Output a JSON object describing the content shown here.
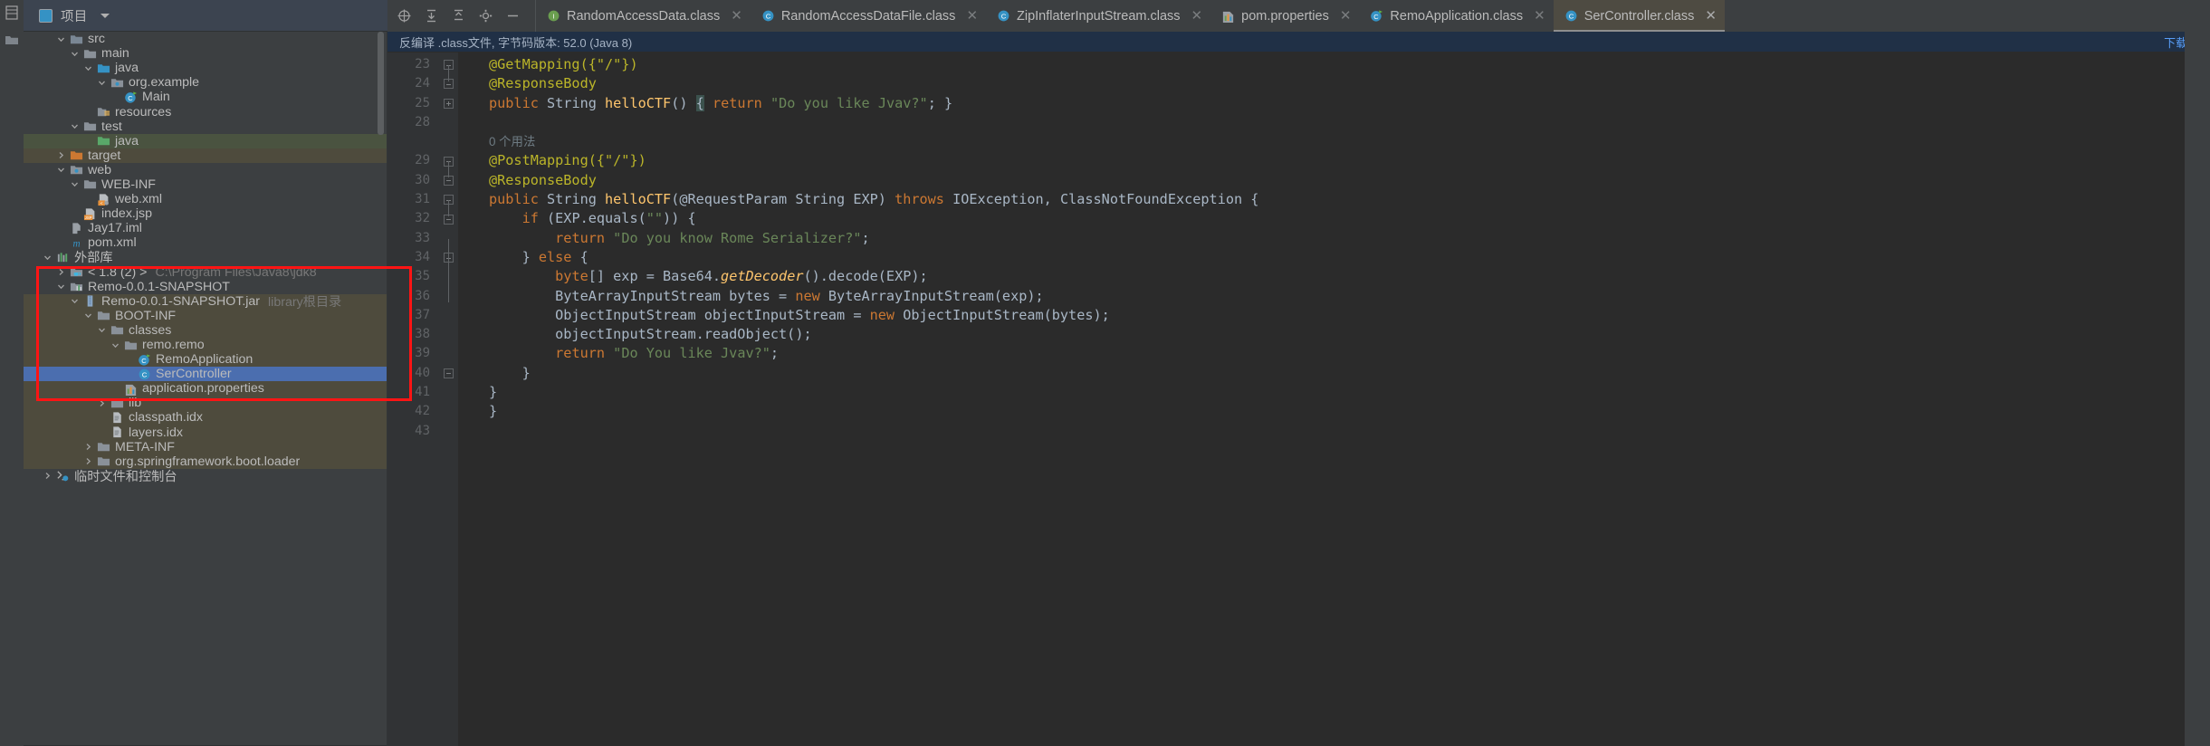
{
  "window": {
    "project_panel_title": "项目",
    "notification_text": "反编译 .class文件, 字节码版本: 52.0 (Java 8)",
    "notification_action": "下载..."
  },
  "toolbar": {
    "icons": [
      {
        "name": "locate-icon",
        "glyph": "target"
      },
      {
        "name": "expand-all-icon",
        "glyph": "expand"
      },
      {
        "name": "collapse-all-icon",
        "glyph": "collapse"
      },
      {
        "name": "settings-gear-icon",
        "glyph": "gear"
      },
      {
        "name": "hide-panel-icon",
        "glyph": "minus"
      }
    ]
  },
  "rail": {
    "items": [
      {
        "name": "project-tool-button",
        "label": "项目"
      },
      {
        "name": "structure-tool-button",
        "label": ""
      }
    ]
  },
  "tabs": [
    {
      "label": "RandomAccessData.class",
      "icon": "interface-icon",
      "icon_color": "#6a9e4f",
      "icon_letter": "I",
      "active": false,
      "close": "✕"
    },
    {
      "label": "RandomAccessDataFile.class",
      "icon": "class-icon",
      "icon_color": "#3592c4",
      "icon_letter": "C",
      "active": false,
      "close": "✕"
    },
    {
      "label": "ZipInflaterInputStream.class",
      "icon": "class-icon",
      "icon_color": "#3592c4",
      "icon_letter": "C",
      "active": false,
      "close": "✕"
    },
    {
      "label": "pom.properties",
      "icon": "properties-icon",
      "icon_color": "#e8913a",
      "icon_letter": "",
      "active": false,
      "close": "✕"
    },
    {
      "label": "RemoApplication.class",
      "icon": "spring-class-icon",
      "icon_color": "#3592c4",
      "icon_letter": "C",
      "active": false,
      "close": "✕"
    },
    {
      "label": "SerController.class",
      "icon": "class-icon",
      "icon_color": "#3592c4",
      "icon_letter": "C",
      "active": true,
      "close": "✕"
    }
  ],
  "tree": [
    {
      "label": "src",
      "indent": 2,
      "arrow": "down",
      "icon": "source-folder-icon",
      "icon_color": "#7a8794",
      "sub": "",
      "state": ""
    },
    {
      "label": "main",
      "indent": 3,
      "arrow": "down",
      "icon": "folder-icon",
      "icon_color": "#8a9199",
      "sub": "",
      "state": ""
    },
    {
      "label": "java",
      "indent": 4,
      "arrow": "down",
      "icon": "source-root-folder-icon",
      "icon_color": "#3592c4",
      "sub": "",
      "state": ""
    },
    {
      "label": "org.example",
      "indent": 5,
      "arrow": "down",
      "icon": "package-icon",
      "icon_color": "#8a9199",
      "sub": "",
      "state": ""
    },
    {
      "label": "Main",
      "indent": 6,
      "arrow": "none",
      "icon": "spring-class-icon",
      "icon_color": "#3592c4",
      "sub": "",
      "state": ""
    },
    {
      "label": "resources",
      "indent": 4,
      "arrow": "none",
      "icon": "resources-folder-icon",
      "icon_color": "#8a9199",
      "sub": "",
      "state": ""
    },
    {
      "label": "test",
      "indent": 3,
      "arrow": "down",
      "icon": "folder-icon",
      "icon_color": "#8a9199",
      "sub": "",
      "state": ""
    },
    {
      "label": "java",
      "indent": 4,
      "arrow": "none",
      "icon": "test-root-folder-icon",
      "icon_color": "#59a869",
      "sub": "",
      "state": "sel-green"
    },
    {
      "label": "target",
      "indent": 2,
      "arrow": "right",
      "icon": "excluded-folder-icon",
      "icon_color": "#cc7832",
      "sub": "",
      "state": "sel-brown"
    },
    {
      "label": "web",
      "indent": 2,
      "arrow": "down",
      "icon": "web-folder-icon",
      "icon_color": "#8a9199",
      "sub": "",
      "state": ""
    },
    {
      "label": "WEB-INF",
      "indent": 3,
      "arrow": "down",
      "icon": "folder-icon",
      "icon_color": "#8a9199",
      "sub": "",
      "state": ""
    },
    {
      "label": "web.xml",
      "indent": 4,
      "arrow": "none",
      "icon": "web-xml-icon",
      "icon_color": "#e8913a",
      "sub": "",
      "state": ""
    },
    {
      "label": "index.jsp",
      "indent": 3,
      "arrow": "none",
      "icon": "jsp-file-icon",
      "icon_color": "#e8913a",
      "sub": "",
      "state": ""
    },
    {
      "label": "Jay17.iml",
      "indent": 2,
      "arrow": "none",
      "icon": "iml-file-icon",
      "icon_color": "#9aa0a6",
      "sub": "",
      "state": ""
    },
    {
      "label": "pom.xml",
      "indent": 2,
      "arrow": "none",
      "icon": "maven-pom-icon",
      "icon_color": "#3592c4",
      "sub": "",
      "state": ""
    },
    {
      "label": "外部库",
      "indent": 1,
      "arrow": "down",
      "icon": "external-libraries-icon",
      "icon_color": "#59a869",
      "sub": "",
      "state": ""
    },
    {
      "label": "< 1.8 (2) >",
      "indent": 2,
      "arrow": "right",
      "icon": "jdk-icon",
      "icon_color": "#8a9199",
      "sub": "C:\\Program Files\\Java8\\jdk8",
      "state": ""
    },
    {
      "label": "Remo-0.0.1-SNAPSHOT",
      "indent": 2,
      "arrow": "down",
      "icon": "library-icon",
      "icon_color": "#8a9199",
      "sub": "",
      "state": ""
    },
    {
      "label": "Remo-0.0.1-SNAPSHOT.jar",
      "indent": 3,
      "arrow": "down",
      "icon": "jar-icon",
      "icon_color": "#7a9cc6",
      "sub": "library根目录",
      "state": "sel-brown"
    },
    {
      "label": "BOOT-INF",
      "indent": 4,
      "arrow": "down",
      "icon": "folder-icon",
      "icon_color": "#8a9199",
      "sub": "",
      "state": "sel-brown"
    },
    {
      "label": "classes",
      "indent": 5,
      "arrow": "down",
      "icon": "folder-icon",
      "icon_color": "#8a9199",
      "sub": "",
      "state": "sel-brown"
    },
    {
      "label": "remo.remo",
      "indent": 6,
      "arrow": "down",
      "icon": "folder-icon",
      "icon_color": "#8a9199",
      "sub": "",
      "state": "sel-brown"
    },
    {
      "label": "RemoApplication",
      "indent": 7,
      "arrow": "none",
      "icon": "spring-class-icon",
      "icon_color": "#3592c4",
      "sub": "",
      "state": "sel-brown"
    },
    {
      "label": "SerController",
      "indent": 7,
      "arrow": "none",
      "icon": "class-icon",
      "icon_color": "#3592c4",
      "sub": "",
      "state": "sel-blue"
    },
    {
      "label": "application.properties",
      "indent": 6,
      "arrow": "none",
      "icon": "properties-icon",
      "icon_color": "#e8913a",
      "sub": "",
      "state": "sel-brown"
    },
    {
      "label": "lib",
      "indent": 5,
      "arrow": "right",
      "icon": "folder-icon",
      "icon_color": "#8a9199",
      "sub": "",
      "state": "sel-brown"
    },
    {
      "label": "classpath.idx",
      "indent": 5,
      "arrow": "none",
      "icon": "file-icon",
      "icon_color": "#9aa0a6",
      "sub": "",
      "state": "sel-brown"
    },
    {
      "label": "layers.idx",
      "indent": 5,
      "arrow": "none",
      "icon": "file-icon",
      "icon_color": "#9aa0a6",
      "sub": "",
      "state": "sel-brown"
    },
    {
      "label": "META-INF",
      "indent": 4,
      "arrow": "right",
      "icon": "folder-icon",
      "icon_color": "#8a9199",
      "sub": "",
      "state": "sel-brown"
    },
    {
      "label": "org.springframework.boot.loader",
      "indent": 4,
      "arrow": "right",
      "icon": "folder-icon",
      "icon_color": "#8a9199",
      "sub": "",
      "state": "sel-brown"
    },
    {
      "label": "临时文件和控制台",
      "indent": 1,
      "arrow": "right",
      "icon": "scratches-icon",
      "icon_color": "#3592c4",
      "sub": "",
      "state": ""
    }
  ],
  "editor": {
    "line_numbers": [
      "23",
      "24",
      "25",
      "28",
      "",
      "29",
      "30",
      "31",
      "32",
      "33",
      "34",
      "35",
      "36",
      "37",
      "38",
      "39",
      "40",
      "41",
      "42",
      "43"
    ],
    "usage_hint": "0 个用法",
    "code_lines": [
      {
        "n": "23",
        "fold": "minus",
        "tokens": [
          {
            "t": "@GetMapping({\"/\"})",
            "c": "ann"
          }
        ]
      },
      {
        "n": "24",
        "fold": "minus-end",
        "tokens": [
          {
            "t": "@ResponseBody",
            "c": "ann"
          }
        ]
      },
      {
        "n": "25",
        "fold": "plus",
        "tokens": [
          {
            "t": "public ",
            "c": "kw"
          },
          {
            "t": "String ",
            "c": "typ"
          },
          {
            "t": "helloCTF",
            "c": "fn"
          },
          {
            "t": "() ",
            "c": "typ"
          },
          {
            "t": "{",
            "c": "brace"
          },
          {
            "t": " ",
            "c": "typ"
          },
          {
            "t": "return ",
            "c": "kw"
          },
          {
            "t": "\"Do you like Jvav?\"",
            "c": "str"
          },
          {
            "t": "; }",
            "c": "typ"
          }
        ]
      },
      {
        "n": "28",
        "fold": "",
        "tokens": []
      },
      {
        "n": "",
        "fold": "",
        "tokens": [
          {
            "t": "0 个用法",
            "c": "hint"
          }
        ]
      },
      {
        "n": "29",
        "fold": "minus",
        "tokens": [
          {
            "t": "@PostMapping({\"/\"})",
            "c": "ann"
          }
        ]
      },
      {
        "n": "30",
        "fold": "minus-end",
        "tokens": [
          {
            "t": "@ResponseBody",
            "c": "ann"
          }
        ]
      },
      {
        "n": "31",
        "fold": "minus",
        "tokens": [
          {
            "t": "public ",
            "c": "kw"
          },
          {
            "t": "String ",
            "c": "typ"
          },
          {
            "t": "helloCTF",
            "c": "fn"
          },
          {
            "t": "(@RequestParam String EXP) ",
            "c": "typ"
          },
          {
            "t": "throws ",
            "c": "kw"
          },
          {
            "t": "IOException, ClassNotFoundException {",
            "c": "typ"
          }
        ]
      },
      {
        "n": "32",
        "fold": "minus",
        "tokens": [
          {
            "t": "    ",
            "c": "typ"
          },
          {
            "t": "if ",
            "c": "kw"
          },
          {
            "t": "(EXP.equals(",
            "c": "typ"
          },
          {
            "t": "\"\"",
            "c": "str"
          },
          {
            "t": ")) {",
            "c": "typ"
          }
        ]
      },
      {
        "n": "33",
        "fold": "",
        "tokens": [
          {
            "t": "        ",
            "c": "typ"
          },
          {
            "t": "return ",
            "c": "kw"
          },
          {
            "t": "\"Do you know Rome Serializer?\"",
            "c": "str"
          },
          {
            "t": ";",
            "c": "typ"
          }
        ]
      },
      {
        "n": "34",
        "fold": "minus-end",
        "tokens": [
          {
            "t": "    } ",
            "c": "typ"
          },
          {
            "t": "else ",
            "c": "kw"
          },
          {
            "t": "{",
            "c": "typ"
          }
        ]
      },
      {
        "n": "35",
        "fold": "",
        "tokens": [
          {
            "t": "        ",
            "c": "typ"
          },
          {
            "t": "byte",
            "c": "kw"
          },
          {
            "t": "[] exp = Base64.",
            "c": "typ"
          },
          {
            "t": "getDecoder",
            "c": "italic"
          },
          {
            "t": "().decode(EXP);",
            "c": "typ"
          }
        ]
      },
      {
        "n": "36",
        "fold": "",
        "tokens": [
          {
            "t": "        ByteArrayInputStream bytes = ",
            "c": "typ"
          },
          {
            "t": "new ",
            "c": "kw"
          },
          {
            "t": "ByteArrayInputStream(exp);",
            "c": "typ"
          }
        ]
      },
      {
        "n": "37",
        "fold": "",
        "tokens": [
          {
            "t": "        ObjectInputStream objectInputStream = ",
            "c": "typ"
          },
          {
            "t": "new ",
            "c": "kw"
          },
          {
            "t": "ObjectInputStream(bytes);",
            "c": "typ"
          }
        ]
      },
      {
        "n": "38",
        "fold": "",
        "tokens": [
          {
            "t": "        objectInputStream.readObject();",
            "c": "typ"
          }
        ]
      },
      {
        "n": "39",
        "fold": "",
        "tokens": [
          {
            "t": "        ",
            "c": "typ"
          },
          {
            "t": "return ",
            "c": "kw"
          },
          {
            "t": "\"Do You like Jvav?\"",
            "c": "str"
          },
          {
            "t": ";",
            "c": "typ"
          }
        ]
      },
      {
        "n": "40",
        "fold": "minus-end",
        "tokens": [
          {
            "t": "    }",
            "c": "typ"
          }
        ]
      },
      {
        "n": "41",
        "fold": "",
        "tokens": [
          {
            "t": "}",
            "c": "typ"
          }
        ]
      },
      {
        "n": "42",
        "fold": "",
        "tokens": [
          {
            "t": "}",
            "c": "typ"
          }
        ]
      },
      {
        "n": "43",
        "fold": "",
        "tokens": []
      }
    ]
  },
  "colors": {
    "accent_blue": "#4b6eaf",
    "annotation_red": "#ff1414",
    "keyword_orange": "#cc7832",
    "string_green": "#6a8759",
    "method_yellow": "#ffc66d",
    "annotation_yellow": "#bbb529",
    "editor_bg": "#2b2b2b",
    "panel_bg": "#3c3f41"
  }
}
